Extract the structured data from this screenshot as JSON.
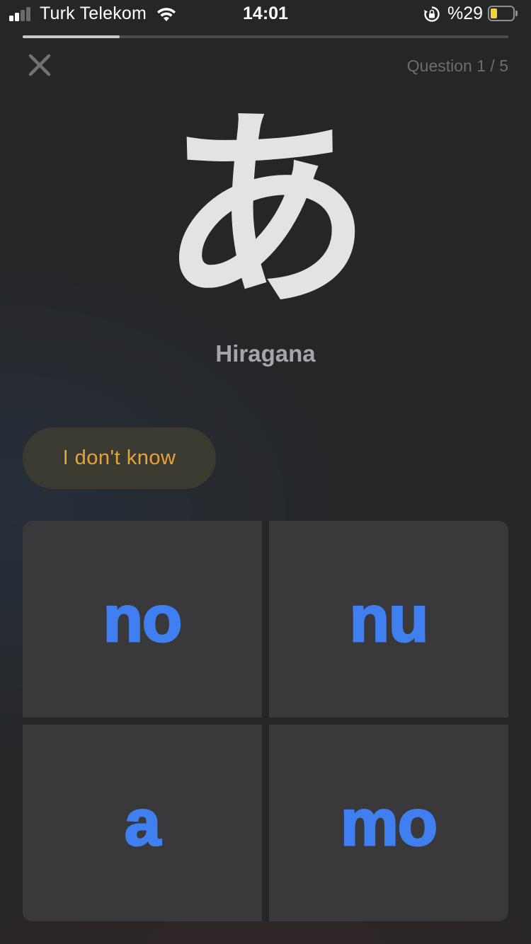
{
  "status_bar": {
    "carrier": "Turk Telekom",
    "time": "14:01",
    "battery_percent_label": "%29",
    "battery_level": 0.29,
    "icons": [
      "signal-icon",
      "wifi-icon",
      "rotation-lock-icon",
      "battery-icon"
    ]
  },
  "quiz": {
    "progress_fraction": 0.2,
    "question_counter": "Question 1 / 5",
    "close_icon": "close-icon",
    "kana": "あ",
    "script_label": "Hiragana",
    "dont_know_label": "I don't know"
  },
  "answers": [
    {
      "label": "no"
    },
    {
      "label": "nu"
    },
    {
      "label": "a"
    },
    {
      "label": "mo"
    }
  ],
  "colors": {
    "background": "#252628",
    "tile": "#39393c",
    "answer_text": "#3f7ff0",
    "dont_know_text": "#e6a33a",
    "dont_know_bg": "#3b3a30",
    "kana": "#e3e3e3",
    "battery_fill": "#f2d23a"
  }
}
